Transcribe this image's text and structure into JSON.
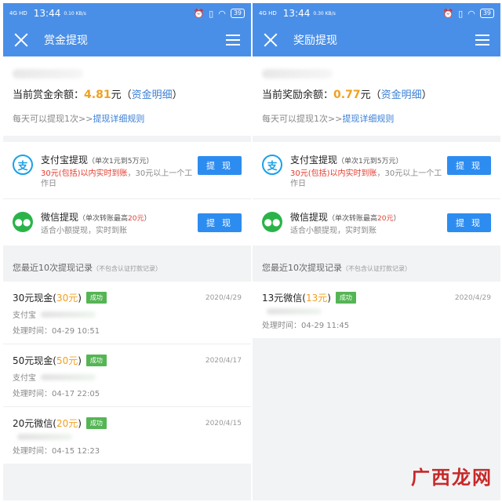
{
  "left": {
    "status": {
      "signal": "4G HD",
      "time": "13:44",
      "net": "0.10 KB/s",
      "battery": "39"
    },
    "nav_title": "赏金提现",
    "balance_label": "当前赏金余额：",
    "balance_amount": "4.81",
    "balance_unit": "元（",
    "balance_link": "资金明细",
    "balance_close": "）",
    "rule_text": "每天可以提现1次>>",
    "rule_link": "提现详细规则",
    "methods": [
      {
        "name": "支付宝提现",
        "note": "（单次1元到5万元）",
        "desc_red": "30元(包括)以内实时到账",
        "desc": "，30元以上一个工作日",
        "button": "提 现"
      },
      {
        "name": "微信提现",
        "note_pre": "（单次转账最高",
        "note_red": "20元",
        "note_post": "）",
        "desc": "适合小额提现，实时到账",
        "button": "提 现"
      }
    ],
    "records_title": "您最近10次提现记录",
    "records_note": "（不包含认证打款记录）",
    "records": [
      {
        "name_pre": "30元现金(",
        "name_amt": "30元",
        "name_post": ")",
        "badge": "成功",
        "date": "2020/4/29",
        "acct": "支付宝",
        "time": "处理时间：04-29 10:51"
      },
      {
        "name_pre": "50元现金(",
        "name_amt": "50元",
        "name_post": ")",
        "badge": "成功",
        "date": "2020/4/17",
        "acct": "支付宝",
        "time": "处理时间：04-17 22:05"
      },
      {
        "name_pre": "20元微信(",
        "name_amt": "20元",
        "name_post": ")",
        "badge": "成功",
        "date": "2020/4/15",
        "acct": "",
        "time": "处理时间：04-15 12:23"
      }
    ]
  },
  "right": {
    "status": {
      "signal": "4G HD",
      "time": "13:44",
      "net": "0.30 KB/s",
      "battery": "39"
    },
    "nav_title": "奖励提现",
    "balance_label": "当前奖励余额：",
    "balance_amount": "0.77",
    "balance_unit": "元（",
    "balance_link": "资金明细",
    "balance_close": "）",
    "rule_text": "每天可以提现1次>>",
    "rule_link": "提现详细规则",
    "methods": [
      {
        "name": "支付宝提现",
        "note": "（单次1元到5万元）",
        "desc_red": "30元(包括)以内实时到账",
        "desc": "，30元以上一个工作日",
        "button": "提 现"
      },
      {
        "name": "微信提现",
        "note_pre": "（单次转账最高",
        "note_red": "20元",
        "note_post": "）",
        "desc": "适合小额提现，实时到账",
        "button": "提 现"
      }
    ],
    "records_title": "您最近10次提现记录",
    "records_note": "（不包含认证打款记录）",
    "records": [
      {
        "name_pre": "13元微信(",
        "name_amt": "13元",
        "name_post": ")",
        "badge": "成功",
        "date": "2020/4/29",
        "acct": "",
        "time": "处理时间：04-29 11:45"
      }
    ]
  },
  "watermark": "广西龙网",
  "colors": {
    "primary": "#4a8fe7",
    "button": "#2d8cf0",
    "gold": "#f0a020",
    "red": "#e23b2e",
    "success": "#55b555"
  },
  "icons": {
    "close": "close-icon",
    "menu": "menu-icon",
    "alipay": "alipay-icon",
    "wechat": "wechat-icon"
  }
}
